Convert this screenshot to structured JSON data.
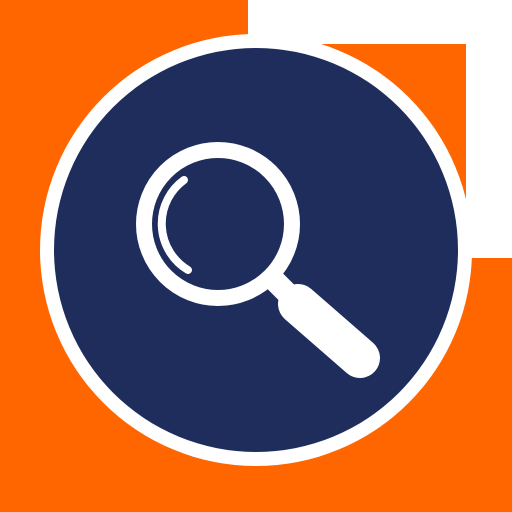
{
  "app": {
    "icon": "magnifying-glass-icon",
    "colors": {
      "accent": "#ff6600",
      "circle": "#1f2d5c",
      "ring": "#ffffff",
      "glyph": "#ffffff"
    }
  }
}
